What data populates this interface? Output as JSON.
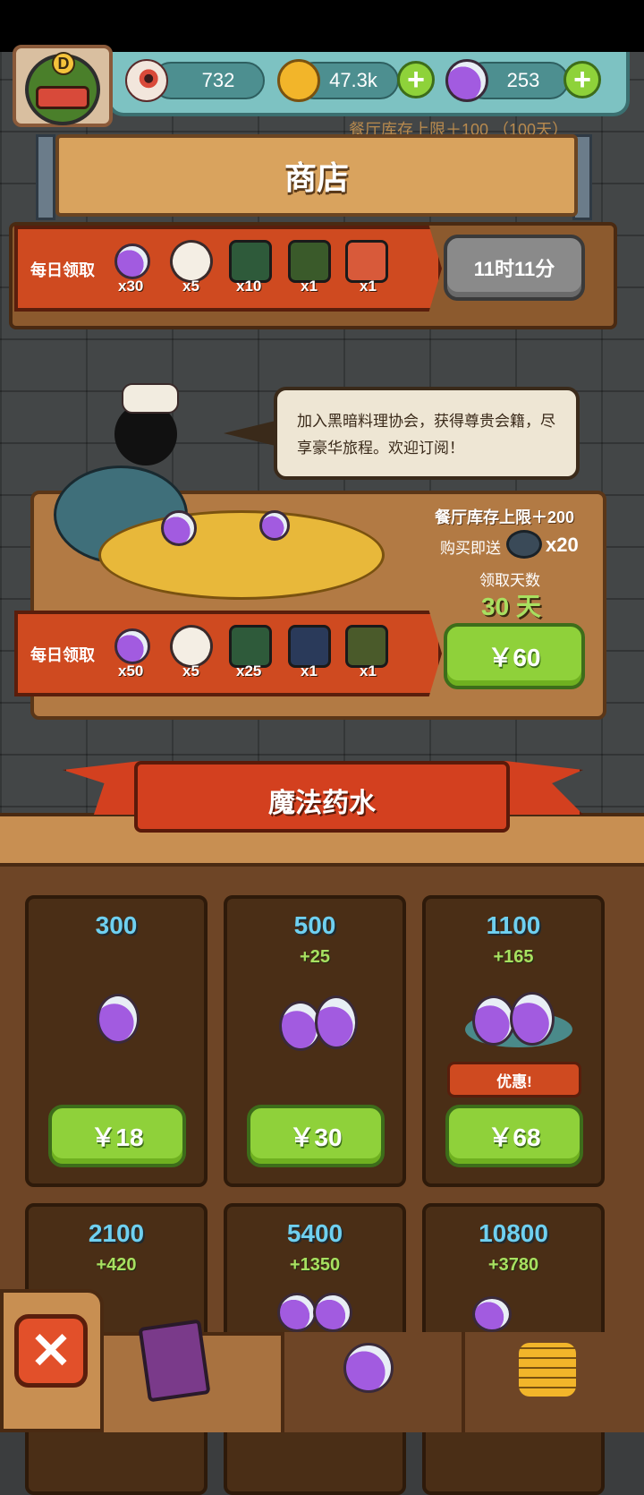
{
  "topbar": {
    "eyeball_count": "732",
    "gold": "47.3k",
    "potion_count": "253",
    "avatar_letter": "D",
    "faded_text": "餐厅库存上限＋100 （100天）"
  },
  "shop": {
    "title": "商店"
  },
  "daily_free": {
    "label": "每日领取",
    "items": [
      {
        "icon": "potion-icon",
        "qty": "x30"
      },
      {
        "icon": "capsule-icon",
        "qty": "x5"
      },
      {
        "icon": "card-pack-icon",
        "qty": "x10"
      },
      {
        "icon": "card-icon",
        "qty": "x1"
      },
      {
        "icon": "card-icon",
        "qty": "x1"
      }
    ],
    "timer_label": "11时11分"
  },
  "subscription": {
    "bubble_text": "加入黑暗料理协会，获得尊贵会籍，尽享豪华旅程。欢迎订阅！",
    "stock_bonus": "餐厅库存上限＋200",
    "gift_label": "购买即送",
    "gift_qty": "x20",
    "days_label": "领取天数",
    "days_value": "30 天",
    "ribbon_label": "每日领取",
    "items": [
      {
        "icon": "potion-icon",
        "qty": "x50"
      },
      {
        "icon": "capsule-icon",
        "qty": "x5"
      },
      {
        "icon": "card-pack-icon",
        "qty": "x25"
      },
      {
        "icon": "card-icon",
        "qty": "x1"
      },
      {
        "icon": "card-icon",
        "qty": "x1"
      }
    ],
    "price": "￥60"
  },
  "potion_section": {
    "title": "魔法药水",
    "packs": [
      {
        "amount": "300",
        "bonus": "",
        "price": "￥18"
      },
      {
        "amount": "500",
        "bonus": "+25",
        "price": "￥30"
      },
      {
        "amount": "1100",
        "bonus": "+165",
        "price": "￥68",
        "tag": "优惠!"
      },
      {
        "amount": "2100",
        "bonus": "+420"
      },
      {
        "amount": "5400",
        "bonus": "+1350"
      },
      {
        "amount": "10800",
        "bonus": "+3780"
      }
    ]
  },
  "colors": {
    "accent_green": "#8fd13a",
    "ribbon_red": "#cf4a20",
    "amount_blue": "#6fd0f0",
    "bonus_green": "#a8e060"
  }
}
